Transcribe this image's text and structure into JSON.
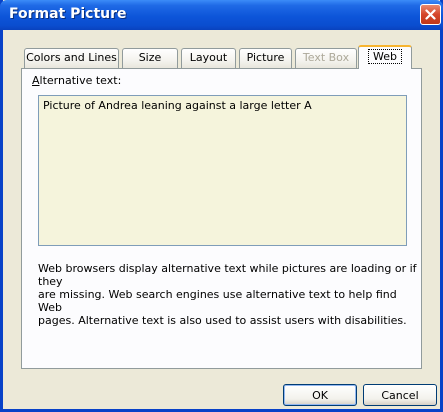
{
  "window": {
    "title": "Format Picture"
  },
  "tabs": [
    {
      "label": "Colors and Lines",
      "state": "normal"
    },
    {
      "label": "Size",
      "state": "normal"
    },
    {
      "label": "Layout",
      "state": "normal"
    },
    {
      "label": "Picture",
      "state": "normal"
    },
    {
      "label": "Text Box",
      "state": "disabled"
    },
    {
      "label": "Web",
      "state": "selected"
    }
  ],
  "web_tab": {
    "alt_text_label_access": "A",
    "alt_text_label_rest": "lternative text:",
    "alt_text_value": "Picture of Andrea leaning against a large letter A",
    "help_line1": "Web browsers display alternative text while pictures are loading or if they",
    "help_line2": "are missing.  Web search engines use alternative text to help find Web",
    "help_line3": "pages.  Alternative text is also used to assist users with disabilities."
  },
  "buttons": {
    "ok": "OK",
    "cancel": "Cancel"
  },
  "colors": {
    "titlebar": "#0a4dcf",
    "dialog_bg": "#ece9d8",
    "textbox_bg": "#f5f4dc",
    "active_tab_accent": "#f7b430",
    "close_button": "#d5462a"
  }
}
